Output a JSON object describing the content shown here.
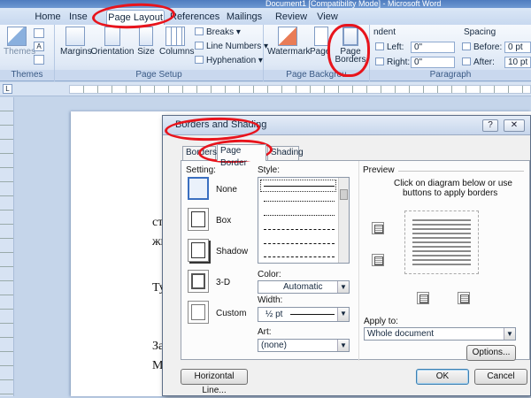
{
  "window": {
    "title": "Document1 [Compatibility Mode] - Microsoft Word"
  },
  "tabs": [
    "Home",
    "Inse",
    "Page Layout",
    "References",
    "Mailings",
    "Review",
    "View"
  ],
  "ribbon": {
    "themes": {
      "label": "Themes",
      "group": "Themes"
    },
    "page_setup": {
      "margins": "Margins",
      "orientation": "Orientation",
      "size": "Size",
      "columns": "Columns",
      "breaks": "Breaks ▾",
      "line_numbers": "Line Numbers ▾",
      "hyphenation": "Hyphenation ▾",
      "group": "Page Setup"
    },
    "page_background": {
      "watermark": "Watermark",
      "page_color": "Page Color",
      "page_borders": "Page Borders",
      "group": "Page Backgrou"
    },
    "paragraph": {
      "indent": "ndent",
      "left_label": "Left:",
      "left_value": "0\"",
      "right_label": "Right:",
      "right_value": "0\"",
      "spacing": "Spacing",
      "before_label": "Before:",
      "before_value": "0 pt",
      "after_label": "After:",
      "after_value": "10 pt",
      "group": "Paragraph"
    }
  },
  "document": {
    "lines": [
      "стр",
      "жи",
      "Тун",
      "За",
      "Ма"
    ]
  },
  "dialog": {
    "title": "Borders and Shading",
    "help": "?",
    "close": "✕",
    "tabs": [
      "Borders",
      "Page Border",
      "Shading"
    ],
    "setting_label": "Setting:",
    "settings": [
      "None",
      "Box",
      "Shadow",
      "3-D",
      "Custom"
    ],
    "style_label": "Style:",
    "color_label": "Color:",
    "color_value": "Automatic",
    "width_label": "Width:",
    "width_value": "½ pt",
    "art_label": "Art:",
    "art_value": "(none)",
    "preview_label": "Preview",
    "preview_hint_1": "Click on diagram below or use",
    "preview_hint_2": "buttons to apply borders",
    "apply_label": "Apply to:",
    "apply_value": "Whole document",
    "options": "Options...",
    "horizontal_line": "Horizontal Line...",
    "ok": "OK",
    "cancel": "Cancel"
  }
}
